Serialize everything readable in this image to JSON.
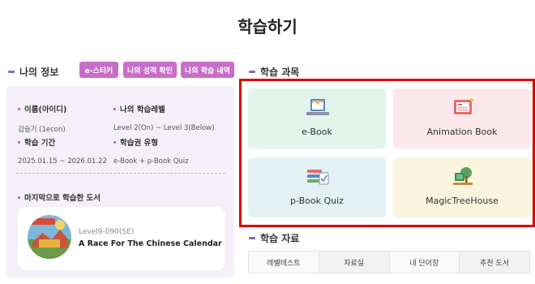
{
  "page_title": "학습하기",
  "my_info": {
    "heading": "나의 정보",
    "buttons": [
      "e-스티커",
      "나의 성적 확인",
      "나의 학습 내역"
    ],
    "items": [
      {
        "label": "이름(아이디)",
        "value": "김슬기 (1econ)"
      },
      {
        "label": "나의 학습레벨",
        "value": "Level 2(On) ~ Level 3(Below)"
      },
      {
        "label": "학습 기간",
        "value": "2025.01.15 ~ 2026.01.22"
      },
      {
        "label": "학습권 유형",
        "value": "e-Book + p-Book Quiz"
      }
    ],
    "last_book_heading": "마지막으로 학습한 도서",
    "last_book": {
      "level": "Level9-090(SE)",
      "title": "A Race For The Chinese Calendar"
    }
  },
  "courses": {
    "heading": "학습 과목",
    "cards": [
      {
        "label": "e-Book",
        "icon": "ebook-icon",
        "color": "#e3f4ec"
      },
      {
        "label": "Animation Book",
        "icon": "animation-book-icon",
        "color": "#fbe8ea"
      },
      {
        "label": "p-Book Quiz",
        "icon": "pbook-quiz-icon",
        "color": "#e3f1f5"
      },
      {
        "label": "MagicTreeHouse",
        "icon": "magic-tree-house-icon",
        "color": "#fbf4df"
      }
    ]
  },
  "materials": {
    "heading": "학습 자료",
    "tabs": [
      "레벨테스트",
      "자료실",
      "내 단어장",
      "추천 도서"
    ]
  },
  "colors": {
    "accent": "#8b63c9",
    "pill": "#c86ec9",
    "highlight": "#e00000"
  }
}
